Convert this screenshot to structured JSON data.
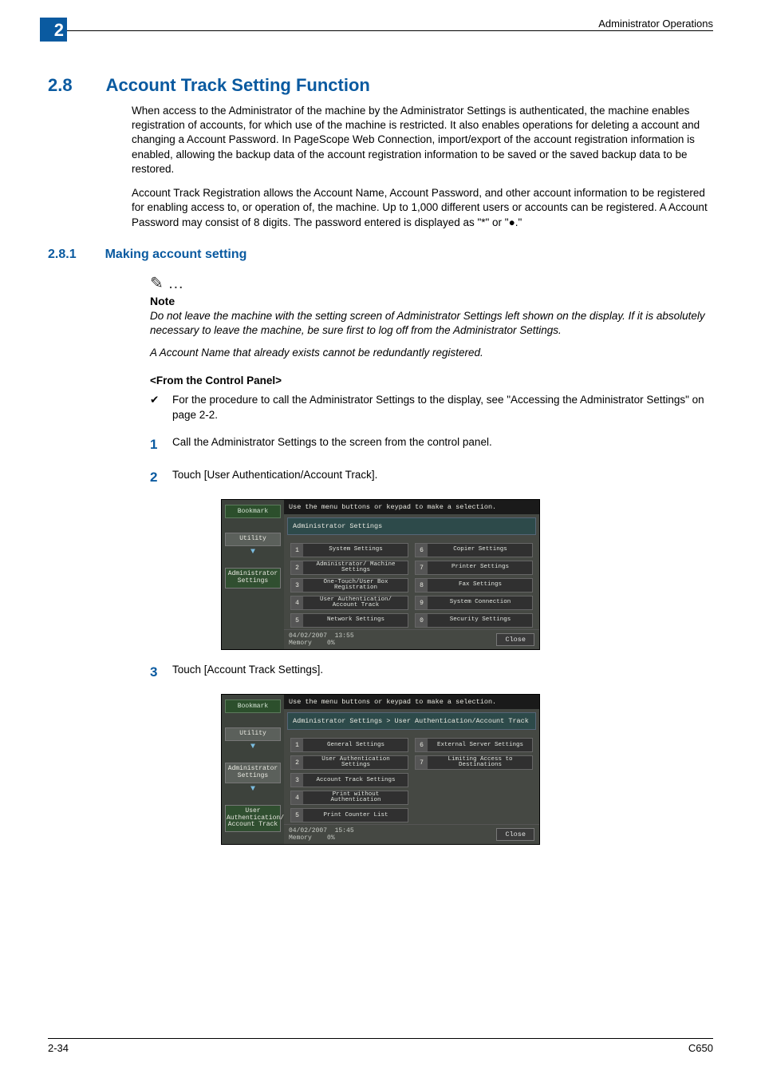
{
  "header": {
    "chapter_num": "2",
    "running": "Administrator Operations"
  },
  "section": {
    "num": "2.8",
    "title": "Account Track Setting Function"
  },
  "para1": "When access to the Administrator of the machine by the Administrator Settings is authenticated, the machine enables registration of accounts, for which use of the machine is restricted. It also enables operations for deleting a account and changing a Account Password. In PageScope Web Connection, import/export of the account registration information is enabled, allowing the backup data of the account registration information to be saved or the saved backup data to be restored.",
  "para2": "Account Track Registration allows the Account Name, Account Password, and other account information to be registered for enabling access to, or operation of, the machine. Up to 1,000 different users or accounts can be registered. A Account Password may consist of 8 digits. The password entered is displayed as \"*\" or \"●.\"",
  "sub": {
    "num": "2.8.1",
    "title": "Making account setting"
  },
  "note": {
    "icon": "✎ …",
    "label": "Note",
    "t1": "Do not leave the machine with the setting screen of Administrator Settings left shown on the display. If it is absolutely necessary to leave the machine, be sure first to log off from the Administrator Settings.",
    "t2": "A Account Name that already exists cannot be redundantly registered."
  },
  "panel_label": "<From the Control Panel>",
  "bullet": {
    "mark": "✔",
    "text": "For the procedure to call the Administrator Settings to the display, see \"Accessing the Administrator Settings\" on page 2-2."
  },
  "steps": {
    "s1": {
      "n": "1",
      "t": "Call the Administrator Settings to the screen from the control panel."
    },
    "s2": {
      "n": "2",
      "t": "Touch [User Authentication/Account Track]."
    },
    "s3": {
      "n": "3",
      "t": "Touch [Account Track Settings]."
    }
  },
  "panel1": {
    "top": "Use the menu buttons or keypad to make a selection.",
    "crumb": "Administrator Settings",
    "side": {
      "bookmark": "Bookmark",
      "utility": "Utility",
      "admin": "Administrator Settings"
    },
    "left": [
      {
        "n": "1",
        "t": "System Settings"
      },
      {
        "n": "2",
        "t": "Administrator/ Machine Settings"
      },
      {
        "n": "3",
        "t": "One-Touch/User Box Registration"
      },
      {
        "n": "4",
        "t": "User Authentication/ Account Track"
      },
      {
        "n": "5",
        "t": "Network Settings"
      }
    ],
    "right": [
      {
        "n": "6",
        "t": "Copier Settings"
      },
      {
        "n": "7",
        "t": "Printer Settings"
      },
      {
        "n": "8",
        "t": "Fax Settings"
      },
      {
        "n": "9",
        "t": "System Connection"
      },
      {
        "n": "0",
        "t": "Security Settings"
      }
    ],
    "foot": {
      "date": "04/02/2007",
      "time": "13:55",
      "mem": "Memory",
      "pct": "0%",
      "close": "Close"
    }
  },
  "panel2": {
    "top": "Use the menu buttons or keypad to make a selection.",
    "crumb": "Administrator Settings > User Authentication/Account Track",
    "side": {
      "bookmark": "Bookmark",
      "utility": "Utility",
      "admin": "Administrator Settings",
      "ua": "User Authentication/ Account Track"
    },
    "left": [
      {
        "n": "1",
        "t": "General Settings"
      },
      {
        "n": "2",
        "t": "User Authentication Settings"
      },
      {
        "n": "3",
        "t": "Account Track Settings"
      },
      {
        "n": "4",
        "t": "Print without Authentication"
      },
      {
        "n": "5",
        "t": "Print Counter List"
      }
    ],
    "right": [
      {
        "n": "6",
        "t": "External Server Settings"
      },
      {
        "n": "7",
        "t": "Limiting Access to Destinations"
      }
    ],
    "foot": {
      "date": "04/02/2007",
      "time": "15:45",
      "mem": "Memory",
      "pct": "0%",
      "close": "Close"
    }
  },
  "footer": {
    "left": "2-34",
    "right": "C650"
  }
}
